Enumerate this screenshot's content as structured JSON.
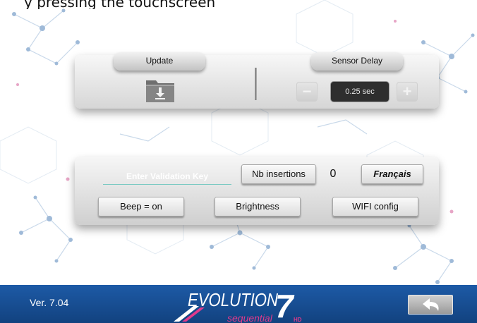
{
  "header": {
    "partial_text": "y pressing the touchscreen"
  },
  "update_panel": {
    "update_label": "Update",
    "download_icon": "folder-download-icon"
  },
  "sensor_panel": {
    "sensor_delay_label": "Sensor Delay",
    "minus_label": "−",
    "plus_label": "+",
    "delay_value": "0.25 sec"
  },
  "settings_panel": {
    "validation_key_placeholder": "Enter Validation Key",
    "nb_insertions_label": "Nb insertions",
    "nb_insertions_value": "0",
    "language_label": "Français",
    "beep_label": "Beep = on",
    "brightness_label": "Brightness",
    "wifi_label": "WIFI config"
  },
  "footer": {
    "version": "Ver. 7.04",
    "logo_text": "EVOLUTION",
    "logo_number": "7",
    "logo_sub": "sequential",
    "logo_badge": "HD",
    "back_icon": "back-arrow-icon"
  },
  "colors": {
    "footer_blue": "#1a5299",
    "logo_pink": "#e03a8c",
    "accent_teal": "#79c9c2"
  }
}
